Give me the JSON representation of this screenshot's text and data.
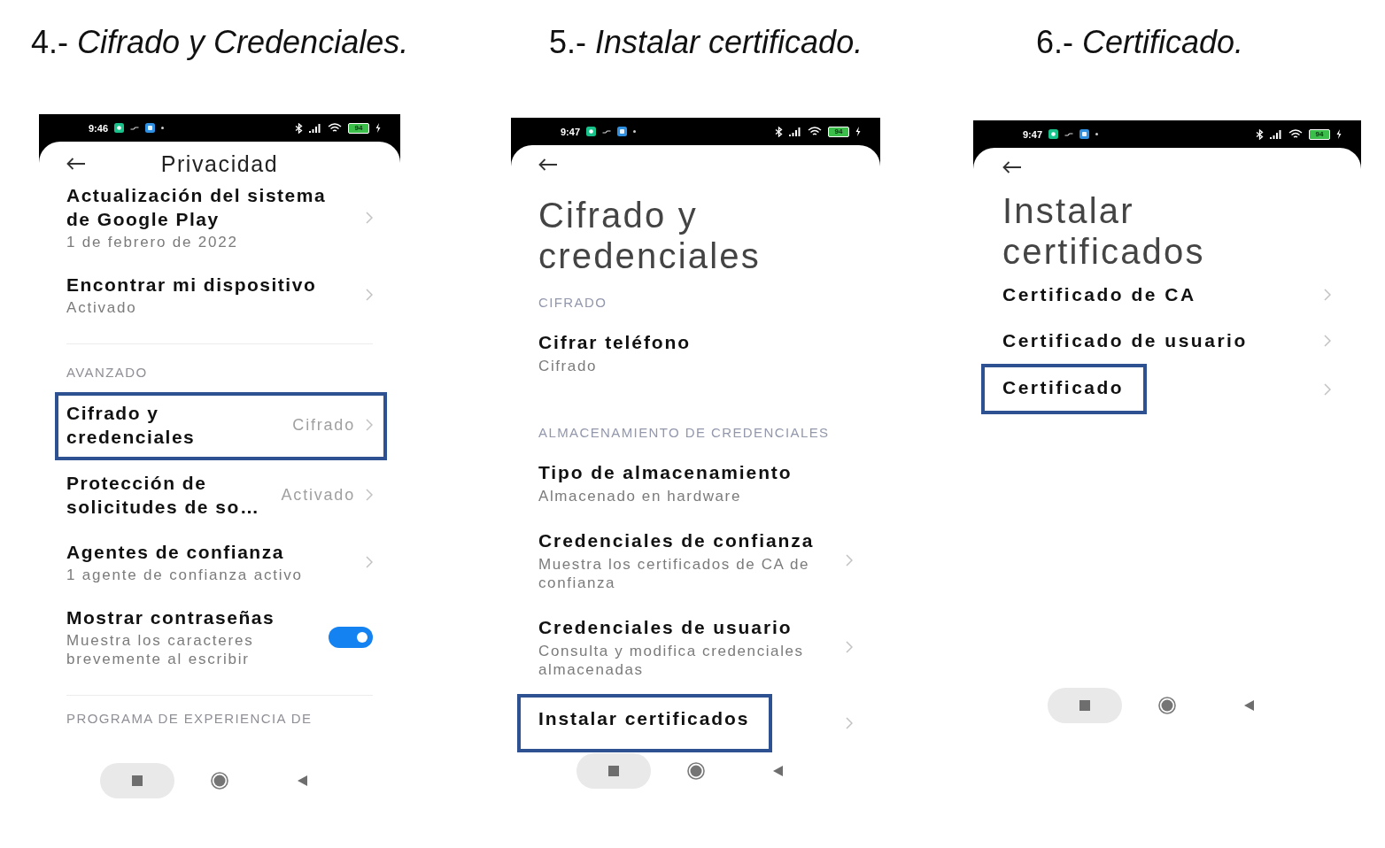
{
  "panels": [
    {
      "caption": "4.- *Cifrado y Credenciales.*",
      "status_bar": {
        "time": "9:46",
        "battery": "94"
      },
      "header": {
        "kind": "centered",
        "title": "Privacidad"
      },
      "items": [
        {
          "kind": "link",
          "title": "Actualización del sistema de Google Play",
          "subtitle": "1 de febrero de 2022",
          "highlighted": false
        },
        {
          "kind": "link",
          "title": "Encontrar mi dispositivo",
          "subtitle": "Activado",
          "highlighted": false
        },
        {
          "kind": "divider"
        },
        {
          "kind": "section",
          "text": "AVANZADO"
        },
        {
          "kind": "link",
          "title": "Cifrado y credenciales",
          "value": "Cifrado",
          "highlighted": true
        },
        {
          "kind": "link",
          "title": "Protección de solicitudes de so…",
          "value": "Activado",
          "highlighted": false
        },
        {
          "kind": "link",
          "title": "Agentes de confianza",
          "subtitle": "1 agente de confianza activo",
          "highlighted": false
        },
        {
          "kind": "toggle",
          "title": "Mostrar contraseñas",
          "subtitle": "Muestra los caracteres brevemente al escribir",
          "on": true,
          "highlighted": false
        },
        {
          "kind": "divider"
        },
        {
          "kind": "section",
          "text": "PROGRAMA DE EXPERIENCIA DE"
        }
      ]
    },
    {
      "caption": "5.- *Instalar certificado.*",
      "status_bar": {
        "time": "9:47",
        "battery": "94"
      },
      "header": {
        "kind": "large",
        "title": "Cifrado y credenciales"
      },
      "items": [
        {
          "kind": "section",
          "text": "CIFRADO"
        },
        {
          "kind": "info",
          "title": "Cifrar teléfono",
          "subtitle": "Cifrado",
          "highlighted": false
        },
        {
          "kind": "section",
          "text": "ALMACENAMIENTO DE CREDENCIALES"
        },
        {
          "kind": "info",
          "title": "Tipo de almacenamiento",
          "subtitle": "Almacenado en hardware",
          "highlighted": false
        },
        {
          "kind": "link",
          "title": "Credenciales de confianza",
          "subtitle": "Muestra los certificados de CA de confianza",
          "highlighted": false
        },
        {
          "kind": "link",
          "title": "Credenciales de usuario",
          "subtitle": "Consulta y modifica credenciales almacenadas",
          "highlighted": false
        },
        {
          "kind": "link",
          "title": "Instalar certificados",
          "highlighted": true
        }
      ]
    },
    {
      "caption": "6.- *Certificado.*",
      "status_bar": {
        "time": "9:47",
        "battery": "94"
      },
      "header": {
        "kind": "large",
        "title": "Instalar certificados"
      },
      "items": [
        {
          "kind": "link",
          "title": "Certificado de CA",
          "highlighted": false
        },
        {
          "kind": "link",
          "title": "Certificado de usuario",
          "highlighted": false
        },
        {
          "kind": "link",
          "title": "Certificado",
          "highlighted": true
        }
      ]
    }
  ]
}
